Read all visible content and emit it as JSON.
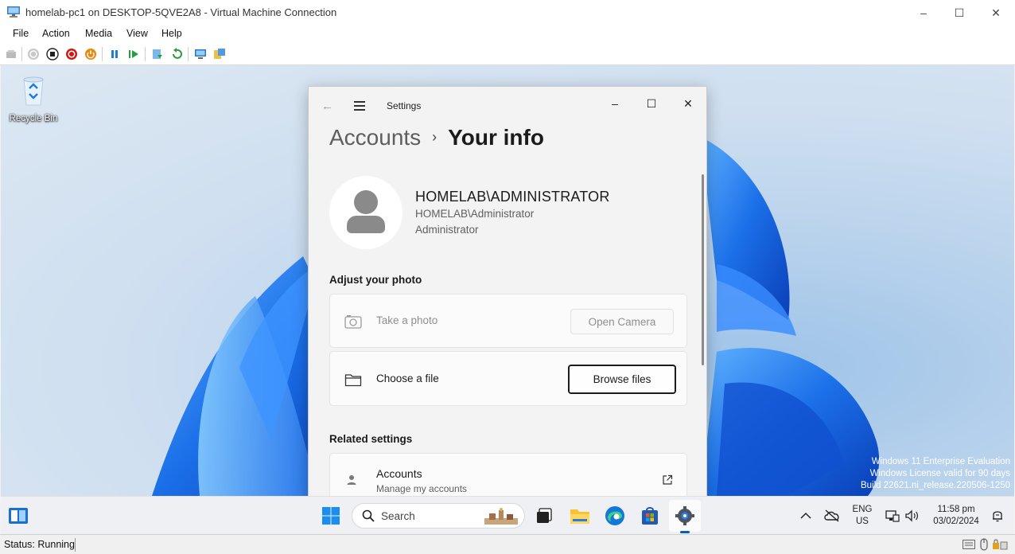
{
  "vm_window": {
    "title": "homelab-pc1 on DESKTOP-5QVE2A8 - Virtual Machine Connection",
    "controls": {
      "minimize": "–",
      "maximize": "☐",
      "close": "✕"
    },
    "menu": [
      "File",
      "Action",
      "Media",
      "View",
      "Help"
    ],
    "toolbar_icons": [
      "ctrl-alt-del-icon",
      "start-icon",
      "turn-off-icon",
      "shut-down-icon",
      "save-state-icon",
      "pause-icon",
      "resume-icon",
      "checkpoint-icon",
      "revert-icon",
      "enhanced-session-icon",
      "share-icon"
    ],
    "status": "Status: Running"
  },
  "desktop": {
    "recycle_bin_label": "Recycle Bin",
    "watermark": {
      "line1": "Windows 11 Enterprise Evaluation",
      "line2": "Windows License valid for 90 days",
      "line3": "Build 22621.ni_release.220506-1250"
    }
  },
  "settings": {
    "app_title": "Settings",
    "breadcrumb": {
      "parent": "Accounts",
      "separator": "›",
      "current": "Your info"
    },
    "user": {
      "display_name": "HOMELAB\\ADMINISTRATOR",
      "account": "HOMELAB\\Administrator",
      "role": "Administrator"
    },
    "adjust_photo": {
      "heading": "Adjust your photo",
      "take_photo_label": "Take a photo",
      "open_camera_button": "Open Camera",
      "choose_file_label": "Choose a file",
      "browse_files_button": "Browse files"
    },
    "related": {
      "heading": "Related settings",
      "accounts_title": "Accounts",
      "accounts_subtitle": "Manage my accounts"
    }
  },
  "taskbar": {
    "search_placeholder": "Search",
    "tray": {
      "language_line1": "ENG",
      "language_line2": "US",
      "time": "11:58 pm",
      "date": "03/02/2024"
    }
  },
  "colors": {
    "accent": "#005fb8",
    "settings_bg": "#f3f3f3",
    "card_bg": "#fbfbfb"
  }
}
